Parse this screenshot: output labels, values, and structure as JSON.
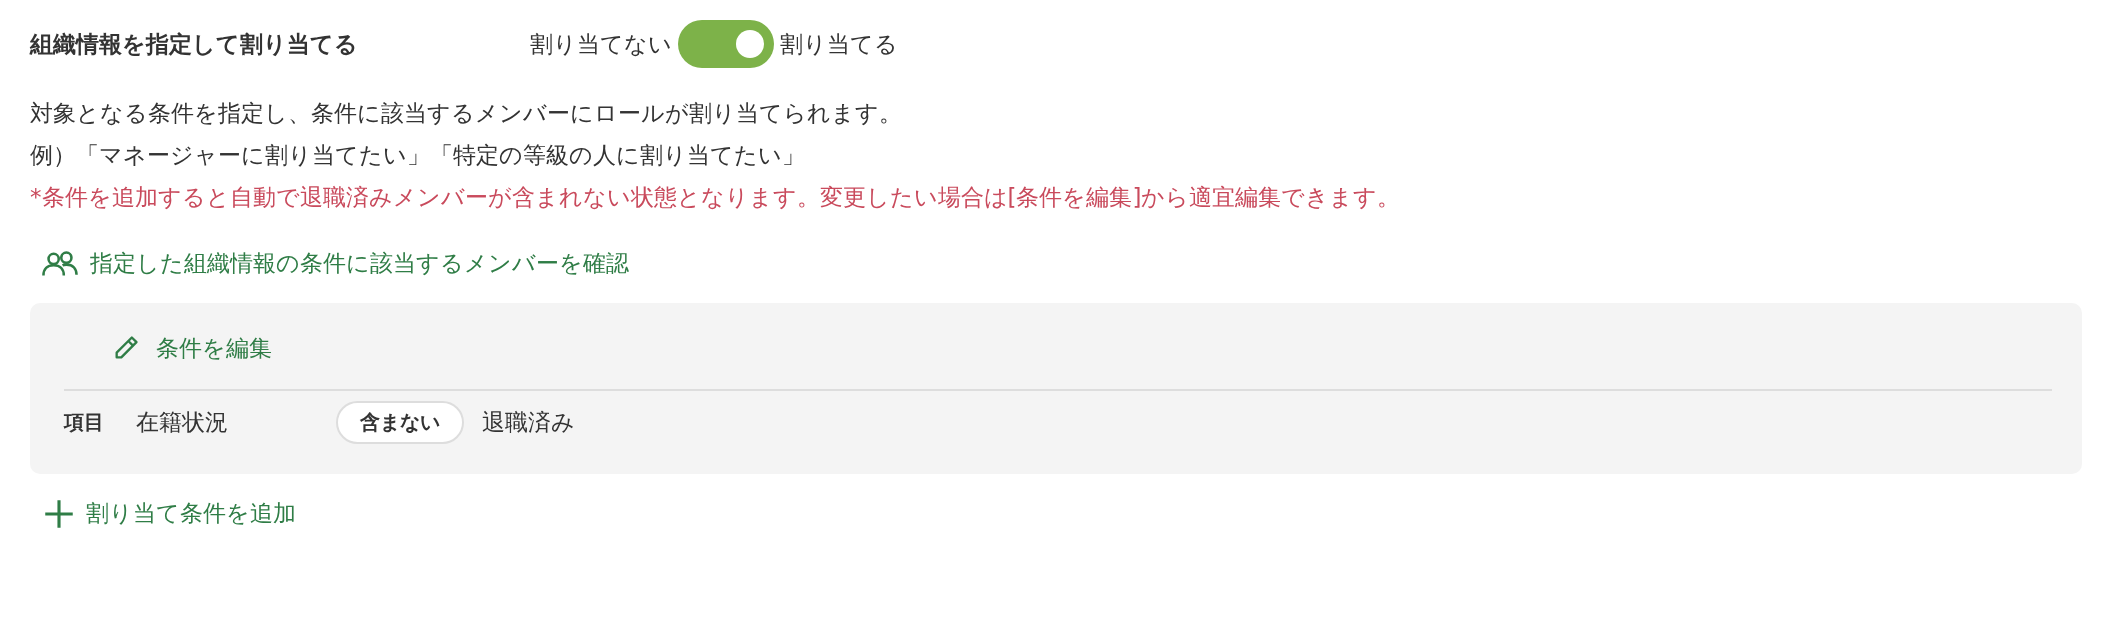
{
  "section": {
    "title": "組織情報を指定して割り当てる",
    "toggle": {
      "off_label": "割り当てない",
      "on_label": "割り当てる",
      "on": true
    }
  },
  "description": [
    "対象となる条件を指定し、条件に該当するメンバーにロールが割り当てられます。",
    "例）「マネージャーに割り当てたい」「特定の等級の人に割り当てたい」"
  ],
  "warning": "*条件を追加すると自動で退職済みメンバーが含まれない状態となります。変更したい場合は[条件を編集]から適宜編集できます。",
  "check_link": "指定した組織情報の条件に該当するメンバーを確認",
  "conditions": {
    "edit_link": "条件を編集",
    "rows": [
      {
        "label": "項目",
        "field": "在籍状況",
        "operator": "含まない",
        "value": "退職済み"
      }
    ]
  },
  "add_link": "割り当て条件を追加"
}
